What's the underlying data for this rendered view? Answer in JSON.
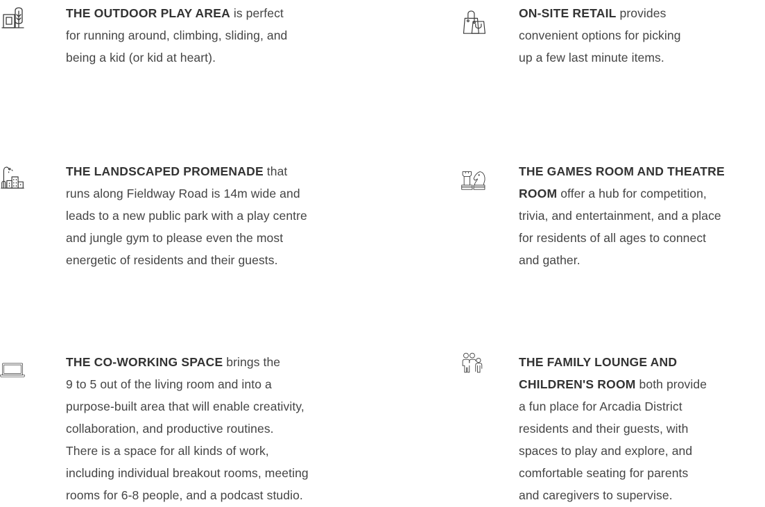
{
  "features": [
    {
      "icon": "play-area-icon",
      "title": "THE OUTDOOR PLAY AREA",
      "lines": [
        " is perfect",
        "for running around, climbing, sliding, and",
        "being a kid (or kid at heart)."
      ]
    },
    {
      "icon": "shopping-bags-icon",
      "title": "ON-SITE RETAIL",
      "lines": [
        " provides",
        "convenient options for picking",
        "up a few last minute items."
      ]
    },
    {
      "icon": "city-park-icon",
      "title": "THE LANDSCAPED PROMENADE",
      "lines": [
        " that",
        "runs along Fieldway Road is 14m wide and",
        "leads to a new public park with a play centre",
        "and jungle gym to please even the most",
        "energetic of residents and their guests."
      ]
    },
    {
      "icon": "chess-pieces-icon",
      "title": "THE GAMES ROOM AND THEATRE",
      "title_2": "ROOM",
      "lines": [
        " offer a hub for competition,",
        "trivia, and entertainment, and a place",
        "for residents of all ages to connect",
        "and gather."
      ]
    },
    {
      "icon": "laptop-icon",
      "title": "THE CO-WORKING SPACE",
      "lines": [
        " brings the",
        "9 to 5 out of the living room and into a",
        "purpose-built area that will enable creativity,",
        "collaboration, and productive routines.",
        "There is a space for all kinds of work,",
        "including individual breakout rooms, meeting",
        "rooms for 6-8 people, and a podcast studio."
      ]
    },
    {
      "icon": "family-icon",
      "title": "THE FAMILY LOUNGE AND",
      "title_2": "CHILDREN'S ROOM",
      "lines": [
        " both provide",
        "a fun place for Arcadia District",
        "residents and their guests, with",
        "spaces to play and explore, and",
        "comfortable seating for parents",
        "and caregivers to supervise."
      ]
    }
  ]
}
